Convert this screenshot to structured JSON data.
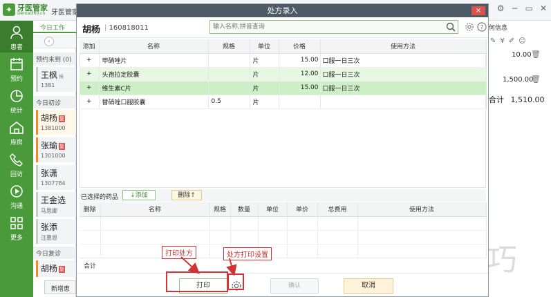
{
  "app": {
    "logo_name": "牙医管家",
    "logo_sub": "Dental360.cn",
    "title_text": "牙医管家",
    "minimize": "−",
    "restore": "▭",
    "close": "✕",
    "gear": "⚙"
  },
  "sidebar": {
    "items": [
      {
        "label": "患者",
        "icon": "patient-icon"
      },
      {
        "label": "预约",
        "icon": "calendar-icon"
      },
      {
        "label": "统计",
        "icon": "pie-chart-icon"
      },
      {
        "label": "库房",
        "icon": "warehouse-icon"
      },
      {
        "label": "回访",
        "icon": "phone-icon"
      },
      {
        "label": "沟通",
        "icon": "play-icon"
      },
      {
        "label": "更多",
        "icon": "grid-icon"
      }
    ]
  },
  "patients": {
    "tab_label": "今日工作",
    "sections": [
      "预约未到 (0)",
      "今日初诊",
      "今日复诊"
    ],
    "cards": [
      {
        "name": "王枫",
        "tag": "候",
        "phone": "1381"
      },
      {
        "name": "胡杨",
        "tag": "复",
        "phone": "1381000"
      },
      {
        "name": "张瑜",
        "tag": "复",
        "phone": "1301000"
      },
      {
        "name": "张潇",
        "tag": "",
        "phone": "1307784"
      },
      {
        "name": "王金选",
        "tag": "",
        "phone": "马思卿"
      },
      {
        "name": "张添",
        "tag": "",
        "phone": "汪惠恩"
      },
      {
        "name": "胡杨",
        "tag": "复",
        "phone": ""
      }
    ],
    "new_button": "新增患"
  },
  "right_panel": {
    "header": "何信息",
    "amount_1": "10.00",
    "amount_2": "1,500.00",
    "total_label": "合计",
    "total_value": "1,510.00"
  },
  "dialog": {
    "title": "处方录入",
    "close": "×",
    "patient_name": "胡杨",
    "patient_id": "160818011",
    "search_placeholder": "输入名称,拼音查询",
    "top_headers": [
      "添加",
      "名称",
      "规格",
      "单位",
      "价格",
      "使用方法"
    ],
    "drugs": [
      {
        "name": "甲硝唑片",
        "spec": "",
        "unit": "片",
        "price": "",
        "usage": ""
      },
      {
        "name": "头孢拉定胶囊",
        "spec": "",
        "unit": "片",
        "price": "12.00",
        "usage": "口服一日三次"
      },
      {
        "name": "维生素C片",
        "spec": "",
        "unit": "片",
        "price": "15.00",
        "usage": "口服一日三次"
      },
      {
        "name": "替硝唑口服胶囊",
        "spec": "0.5",
        "unit": "片",
        "price": "",
        "usage": ""
      }
    ],
    "first_row_price": "15.00",
    "first_row_usage": "口服一日三次",
    "selected_label": "已选择的药品",
    "add_button": "↓添加",
    "delete_button": "删除↑",
    "bottom_headers": [
      "删除",
      "名称",
      "规格",
      "数量",
      "单位",
      "单价",
      "总费用",
      "使用方法"
    ],
    "total_label": "合计",
    "print_button": "打印",
    "confirm_button": "确认",
    "cancel_button": "取消"
  },
  "annotations": {
    "print_label": "打印处方",
    "settings_label": "处方打印设置"
  },
  "watermark": "软件技巧",
  "colors": {
    "brand_green": "#4a9a3c",
    "annotation_red": "#d23333",
    "title_bar": "#4e5b66"
  }
}
